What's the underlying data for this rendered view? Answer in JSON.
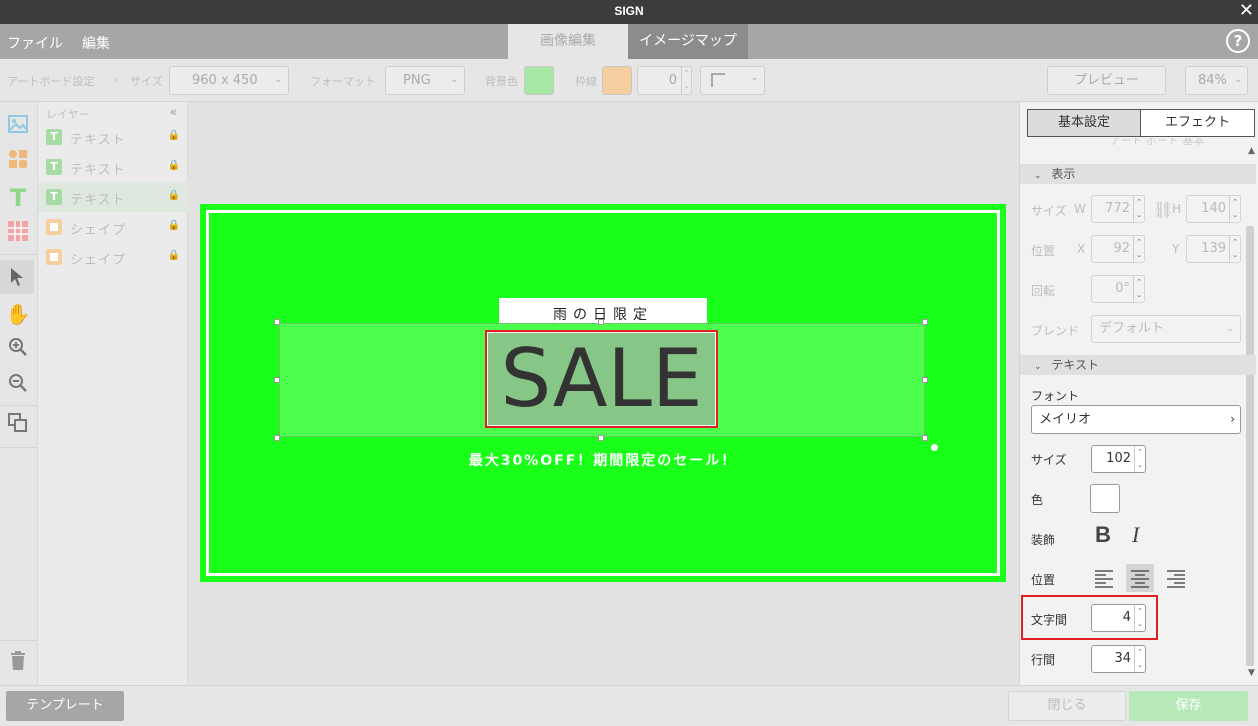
{
  "app": {
    "title": "SIGN",
    "close": "✕"
  },
  "menu": {
    "file": "ファイル",
    "edit": "編集",
    "tabs": [
      "画像編集",
      "イメージマップ"
    ],
    "help": "?"
  },
  "toolbar": {
    "artboard_label": "アートボード設定",
    "size_label": "サイズ",
    "size_value": "960 x 450",
    "format_label": "フォーマット",
    "format_value": "PNG",
    "bg_label": "背景色",
    "bg_color": "#a8e6a4",
    "border_label": "枠線",
    "border_color": "#f5cfa0",
    "border_width": "0",
    "preview": "プレビュー",
    "zoom": "84%"
  },
  "layers": {
    "title": "レイヤー",
    "collapse": "«",
    "items": [
      {
        "type": "text",
        "icon": "T",
        "label": "テキスト"
      },
      {
        "type": "text",
        "icon": "T",
        "label": "テキスト"
      },
      {
        "type": "text",
        "icon": "T",
        "label": "テキスト"
      },
      {
        "type": "shape",
        "icon": "",
        "label": "シェイプ"
      },
      {
        "type": "shape",
        "icon": "",
        "label": "シェイプ"
      }
    ]
  },
  "artboard": {
    "bg": "#1aff1a",
    "subtitle": "雨の日限定",
    "headline": "SALE",
    "caption": "最大30%OFF！期間限定のセール！"
  },
  "panel": {
    "tabs": {
      "basic": "基本設定",
      "effect": "エフェクト"
    },
    "cut_text": "アート ボード 基本",
    "display": {
      "title": "表示",
      "size_label": "サイズ",
      "w_label": "W",
      "w": "772",
      "h_label": "H",
      "h": "140",
      "pos_label": "位置",
      "x_label": "X",
      "x": "92",
      "y_label": "Y",
      "y": "139",
      "rotate_label": "回転",
      "rotate": "0°",
      "blend_label": "ブレンド",
      "blend": "デフォルト"
    },
    "text": {
      "title": "テキスト",
      "font_label": "フォント",
      "font": "メイリオ",
      "size_label": "サイズ",
      "size": "102",
      "color_label": "色",
      "deco_label": "装飾",
      "align_label": "位置",
      "spacing_label": "文字間",
      "spacing": "4",
      "line_label": "行間",
      "line": "34"
    }
  },
  "footer": {
    "template": "テンプレート",
    "close": "閉じる",
    "save": "保存"
  }
}
